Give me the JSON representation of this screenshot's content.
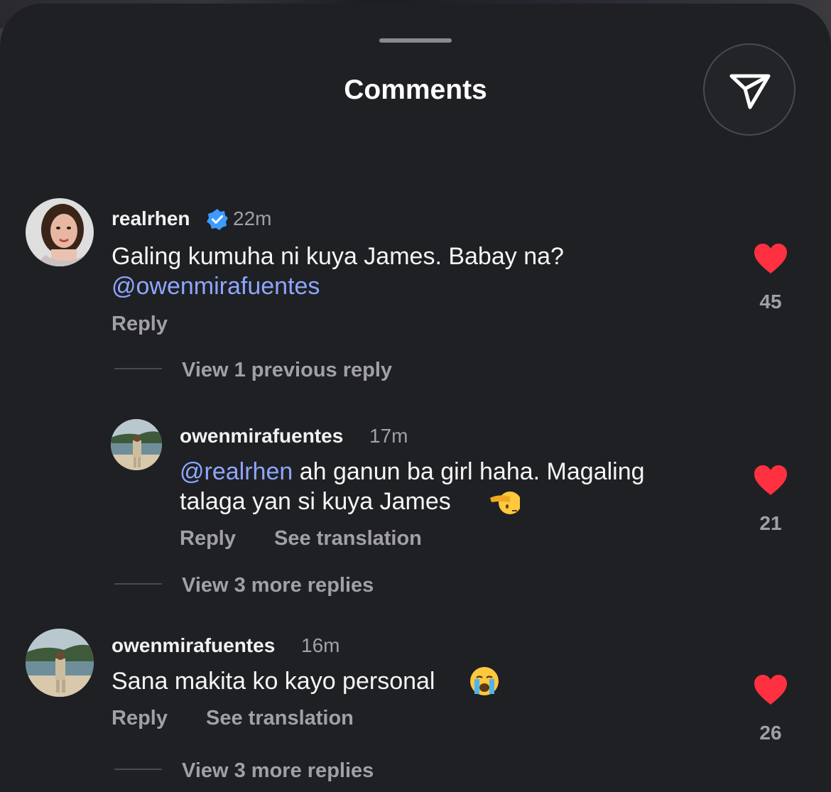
{
  "header": {
    "title": "Comments"
  },
  "icons": {
    "share": "send-icon",
    "like": "heart-icon",
    "verified": "verified-badge-icon"
  },
  "colors": {
    "sheet": "#1f2023",
    "mention": "#8ea6ff",
    "heart": "#ff3040",
    "verified": "#3b9bff"
  },
  "comments": [
    {
      "username": "realrhen",
      "verified": true,
      "time": "22m",
      "text": "Galing kumuha ni kuya James. Babay na?",
      "mention_line": "@owenmirafuentes",
      "reply_label": "Reply",
      "likes": "45",
      "view_replies": "View 1 previous reply"
    },
    {
      "username": "owenmirafuentes",
      "time": "17m",
      "mention": "@realrhen",
      "text_line1": " ah ganun ba girl haha. Magaling",
      "text_line2": "talaga yan si kuya James",
      "emoji": "🫡",
      "reply_label": "Reply",
      "translate_label": "See translation",
      "likes": "21",
      "view_replies": "View 3 more replies"
    },
    {
      "username": "owenmirafuentes",
      "time": "16m",
      "text": "Sana makita ko kayo personal",
      "emoji": "😭",
      "reply_label": "Reply",
      "translate_label": "See translation",
      "likes": "26",
      "view_replies": "View 3 more replies"
    }
  ]
}
